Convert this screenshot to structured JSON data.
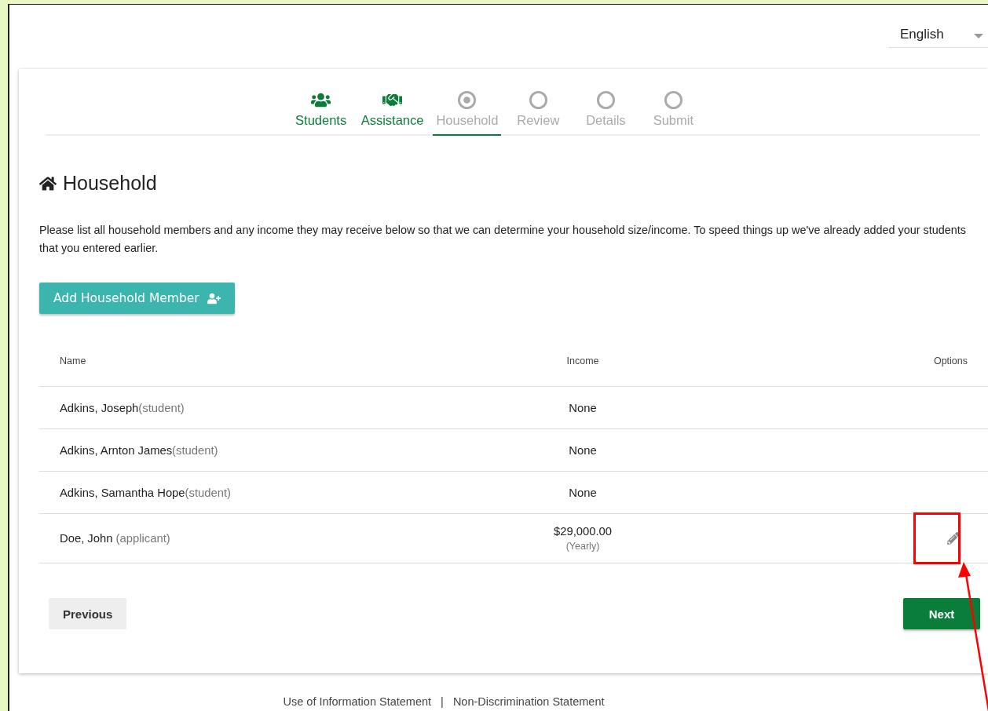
{
  "language": {
    "value": "English"
  },
  "steps": [
    {
      "label": "Students",
      "kind": "done",
      "selected": false
    },
    {
      "label": "Assistance",
      "kind": "done",
      "selected": false
    },
    {
      "label": "Household",
      "kind": "current",
      "selected": true
    },
    {
      "label": "Review",
      "kind": "pending",
      "selected": false
    },
    {
      "label": "Details",
      "kind": "pending",
      "selected": false
    },
    {
      "label": "Submit",
      "kind": "pending",
      "selected": false
    }
  ],
  "heading": "Household",
  "intro": "Please list all household members and any income they may receive below so that we can determine your household size/income. To speed things up we've already added your students that you entered earlier.",
  "add_button": "Add Household Member",
  "table": {
    "columns": [
      "Name",
      "Income",
      "Options"
    ],
    "rows": [
      {
        "name": "Adkins, Joseph",
        "role": "(student)",
        "income": "None",
        "editable": false
      },
      {
        "name": "Adkins, Arnton James",
        "role": "(student)",
        "income": "None",
        "editable": false
      },
      {
        "name": "Adkins, Samantha Hope",
        "role": "(student)",
        "income": "None",
        "editable": false
      },
      {
        "name": "Doe, John ",
        "role": "(applicant)",
        "income": "$29,000.00",
        "period": "(Yearly)",
        "editable": true
      }
    ]
  },
  "buttons": {
    "previous": "Previous",
    "next": "Next"
  },
  "footer": {
    "links": [
      "Use of Information Statement",
      "Non-Discrimination Statement"
    ],
    "separator": "|"
  }
}
